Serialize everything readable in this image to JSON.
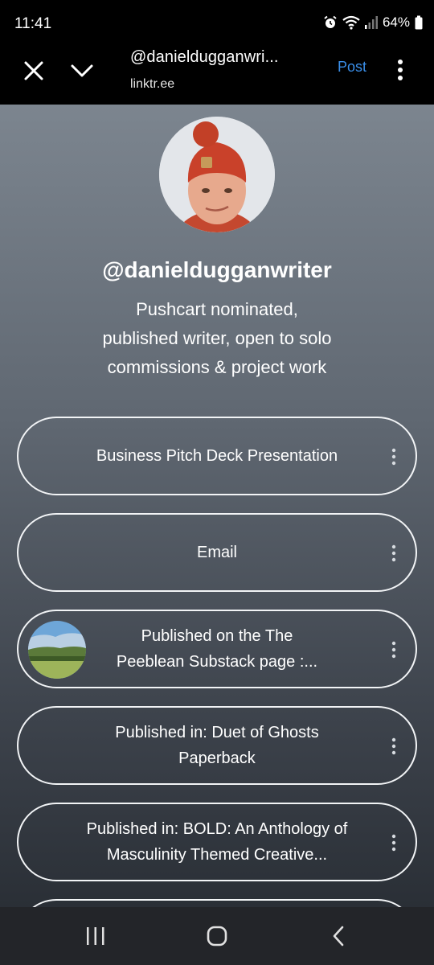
{
  "status": {
    "time": "11:41",
    "battery": "64%",
    "icons": [
      "alarm-icon",
      "wifi-icon",
      "signal-icon",
      "battery-icon"
    ]
  },
  "browser": {
    "title": "@danieldugganwri...",
    "domain": "linktr.ee",
    "post_label": "Post",
    "icons": [
      "close-icon",
      "chevron-down-icon",
      "more-vertical-icon"
    ],
    "accent_color": "#3a8ee8"
  },
  "profile": {
    "handle": "@danieldugganwriter",
    "bio_lines": [
      "Pushcart nominated,",
      "published writer, open to solo",
      "commissions & project work"
    ]
  },
  "links": [
    {
      "label": "Business Pitch Deck Presentation",
      "has_thumbnail": false
    },
    {
      "label": "Email",
      "has_thumbnail": false
    },
    {
      "label_lines": [
        "Published on the The",
        "Peeblean Substack page :..."
      ],
      "has_thumbnail": true
    },
    {
      "label_lines": [
        "Published in: Duet of Ghosts",
        "Paperback"
      ],
      "has_thumbnail": false
    },
    {
      "label_lines": [
        "Published in: BOLD: An Anthology of",
        "Masculinity Themed Creative..."
      ],
      "has_thumbnail": false
    }
  ],
  "nav": {
    "icons": [
      "recent-apps-icon",
      "home-icon",
      "back-icon"
    ]
  }
}
